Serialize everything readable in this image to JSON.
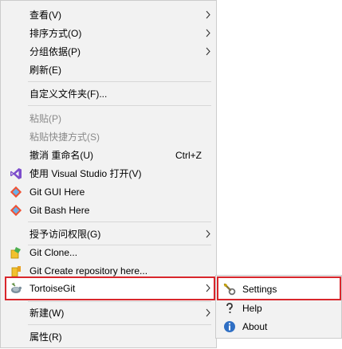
{
  "context_menu": {
    "items": [
      {
        "label": "查看(V)"
      },
      {
        "label": "排序方式(O)"
      },
      {
        "label": "分组依据(P)"
      },
      {
        "label": "刷新(E)"
      },
      {
        "label": "自定义文件夹(F)..."
      },
      {
        "label": "粘贴(P)"
      },
      {
        "label": "粘贴快捷方式(S)"
      },
      {
        "label": "撤消 重命名(U)",
        "shortcut": "Ctrl+Z"
      },
      {
        "label": "使用 Visual Studio 打开(V)"
      },
      {
        "label": "Git GUI Here"
      },
      {
        "label": "Git Bash Here"
      },
      {
        "label": "授予访问权限(G)"
      },
      {
        "label": "Git Clone..."
      },
      {
        "label": "Git Create repository here..."
      },
      {
        "label": "TortoiseGit"
      },
      {
        "label": "新建(W)"
      },
      {
        "label": "属性(R)"
      }
    ]
  },
  "tortoisegit_submenu": {
    "items": [
      {
        "label": "Settings",
        "icon": "settings-wrench-icon"
      },
      {
        "label": "Help",
        "icon": "help-question-icon"
      },
      {
        "label": "About",
        "icon": "about-info-icon"
      }
    ]
  },
  "colors": {
    "menu_background": "#f2f2f2",
    "highlight_border": "#d9262c",
    "disabled_text": "#8a8a8a"
  }
}
